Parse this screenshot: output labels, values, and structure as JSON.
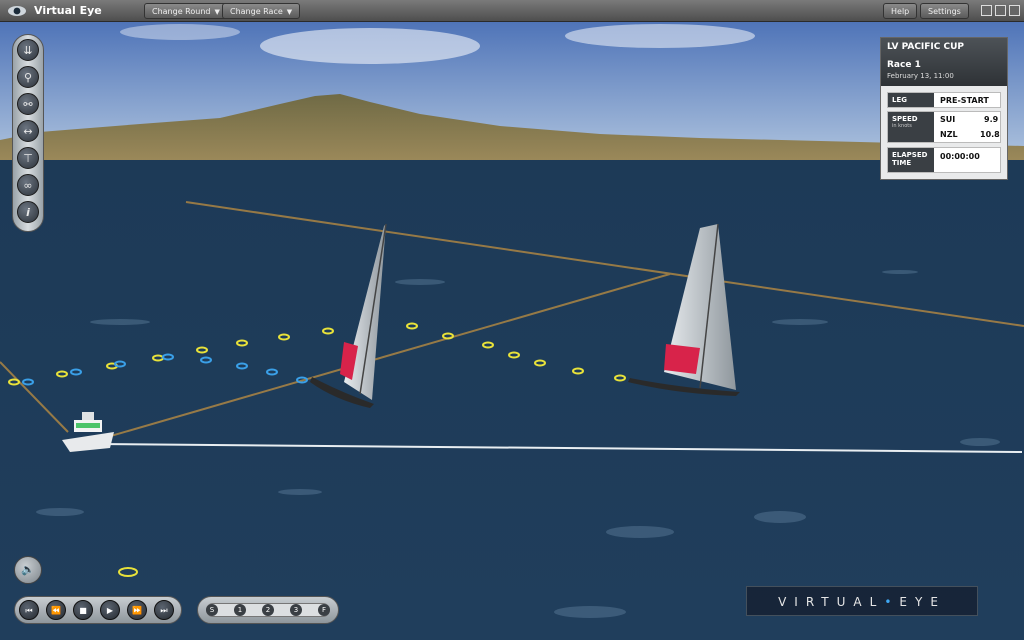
{
  "app": {
    "title": "Virtual Eye"
  },
  "toolbar": {
    "change_round": "Change Round",
    "change_race": "Change Race",
    "help": "Help",
    "settings": "Settings"
  },
  "panel": {
    "cup": "LV PACIFIC CUP",
    "race": "Race 1",
    "date": "February 13, 11:00",
    "leg_label": "LEG",
    "leg_value": "PRE-START",
    "speed_label": "SPEED",
    "speed_unit": "in knots",
    "speeds": [
      {
        "team": "SUI",
        "speed": "9.9"
      },
      {
        "team": "NZL",
        "speed": "10.8"
      }
    ],
    "elapsed_label_1": "ELAPSED",
    "elapsed_label_2": "TIME",
    "elapsed_value": "00:00:00"
  },
  "tools": [
    "boats-icon",
    "marks-icon",
    "follow-icon",
    "width-icon",
    "camera-icon",
    "link-icon",
    "info-icon"
  ],
  "timeline": {
    "marks": [
      "S",
      "1",
      "2",
      "3",
      "F"
    ]
  },
  "brand": {
    "left": "VIRTUAL",
    "right": "EYE"
  },
  "colors": {
    "sea": "#1f3b57",
    "sky": "#6a8fc4",
    "land": "#8a7a4a",
    "sail_logo": "#e0204a",
    "mark_yellow": "#e8e23a",
    "mark_blue": "#3aa0e8"
  }
}
